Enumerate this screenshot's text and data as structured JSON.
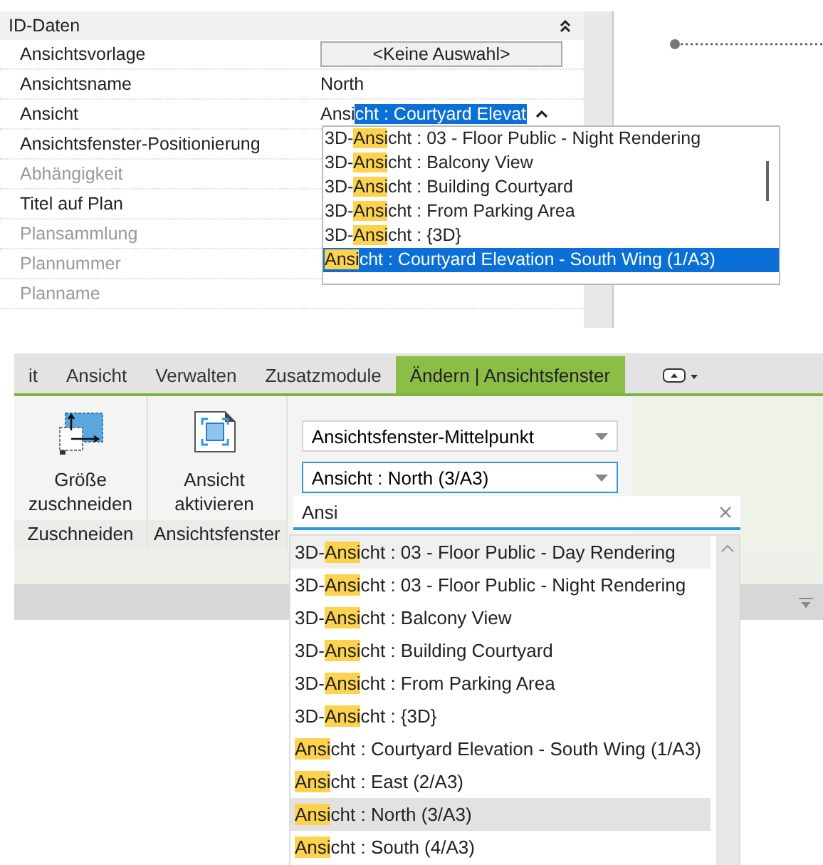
{
  "properties": {
    "title": "ID-Daten",
    "rows": [
      {
        "label": "Ansichtsvorlage",
        "disabled": false,
        "kind": "button",
        "value": "<Keine Auswahl>"
      },
      {
        "label": "Ansichtsname",
        "disabled": false,
        "kind": "text",
        "value": "North"
      },
      {
        "label": "Ansicht",
        "disabled": false,
        "kind": "combo",
        "typed": "Ansi",
        "selection": "cht : Courtyard Elevat"
      },
      {
        "label": "Ansichtsfenster-Positionierung",
        "disabled": false,
        "kind": "none"
      },
      {
        "label": "Abhängigkeit",
        "disabled": true,
        "kind": "none"
      },
      {
        "label": "Titel auf Plan",
        "disabled": false,
        "kind": "none"
      },
      {
        "label": "Plansammlung",
        "disabled": true,
        "kind": "none"
      },
      {
        "label": "Plannummer",
        "disabled": true,
        "kind": "none"
      },
      {
        "label": "Planname",
        "disabled": true,
        "kind": "none"
      }
    ],
    "dropdown": [
      {
        "prefix": "3D-",
        "match": "Ansi",
        "rest": "cht : 03 - Floor Public - Night Rendering",
        "selected": false
      },
      {
        "prefix": "3D-",
        "match": "Ansi",
        "rest": "cht : Balcony View",
        "selected": false
      },
      {
        "prefix": "3D-",
        "match": "Ansi",
        "rest": "cht : Building Courtyard",
        "selected": false
      },
      {
        "prefix": "3D-",
        "match": "Ansi",
        "rest": "cht : From Parking Area",
        "selected": false
      },
      {
        "prefix": "3D-",
        "match": "Ansi",
        "rest": "cht : {3D}",
        "selected": false
      },
      {
        "match": "Ansi",
        "rest": "cht : Courtyard Elevation - South Wing (1/A3)",
        "selected": true
      }
    ]
  },
  "ribbon": {
    "tabs": [
      {
        "label": "it",
        "selected": false
      },
      {
        "label": "Ansicht",
        "selected": false
      },
      {
        "label": "Verwalten",
        "selected": false
      },
      {
        "label": "Zusatzmodule",
        "selected": false
      },
      {
        "label": "Ändern | Ansichtsfenster",
        "selected": true
      }
    ],
    "groups": [
      {
        "kind": "crop",
        "button": "Größe zuschneiden",
        "label": "Zuschneiden"
      },
      {
        "kind": "activate",
        "button": "Ansicht aktivieren",
        "label": "Ansichtsfenster"
      }
    ],
    "combos": [
      "Ansichtsfenster-Mittelpunkt",
      "Ansicht : North (3/A3)"
    ],
    "search": "Ansi",
    "list": [
      {
        "prefix": "3D-",
        "match": "Ansi",
        "rest": "cht : 03 - Floor Public - Day Rendering",
        "selected": false,
        "hovered": true
      },
      {
        "prefix": "3D-",
        "match": "Ansi",
        "rest": "cht : 03 - Floor Public - Night Rendering",
        "selected": false,
        "hovered": false
      },
      {
        "prefix": "3D-",
        "match": "Ansi",
        "rest": "cht : Balcony View",
        "selected": false,
        "hovered": false
      },
      {
        "prefix": "3D-",
        "match": "Ansi",
        "rest": "cht : Building Courtyard",
        "selected": false,
        "hovered": false
      },
      {
        "prefix": "3D-",
        "match": "Ansi",
        "rest": "cht : From Parking Area",
        "selected": false,
        "hovered": false
      },
      {
        "prefix": "3D-",
        "match": "Ansi",
        "rest": "cht : {3D}",
        "selected": false,
        "hovered": false
      },
      {
        "match": "Ansi",
        "rest": "cht : Courtyard Elevation - South Wing (1/A3)",
        "selected": false,
        "hovered": false
      },
      {
        "match": "Ansi",
        "rest": "cht : East (2/A3)",
        "selected": false,
        "hovered": false
      },
      {
        "match": "Ansi",
        "rest": "cht : North (3/A3)",
        "selected": true,
        "hovered": false
      },
      {
        "match": "Ansi",
        "rest": "cht : South (4/A3)",
        "selected": false,
        "hovered": false
      }
    ]
  }
}
